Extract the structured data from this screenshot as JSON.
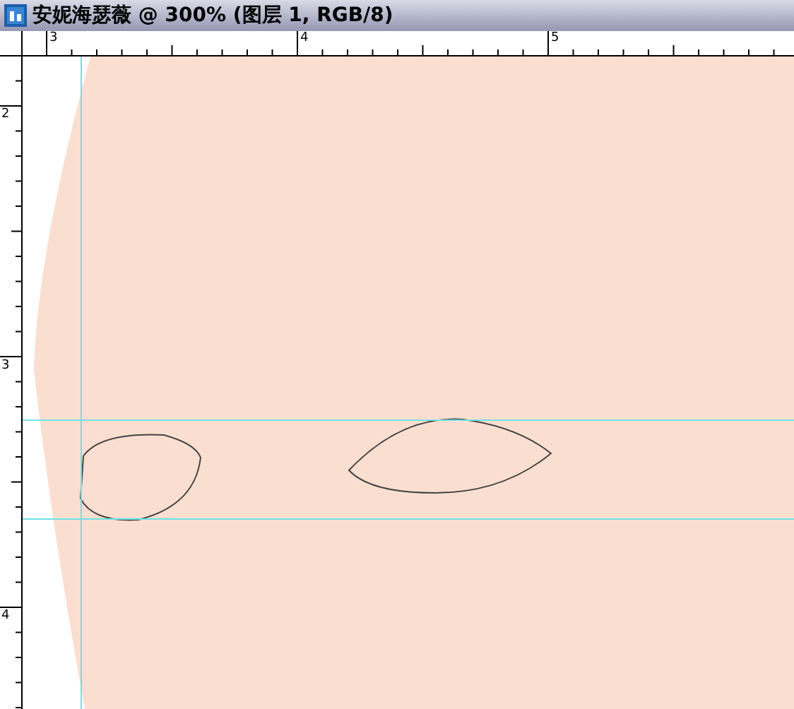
{
  "window": {
    "title": "安妮海瑟薇 @ 300% (图层 1, RGB/8)"
  },
  "horizontal_ruler": {
    "labels": [
      "3",
      "4",
      "5"
    ]
  },
  "vertical_ruler": {
    "labels": [
      "2",
      "3",
      "4"
    ]
  }
}
